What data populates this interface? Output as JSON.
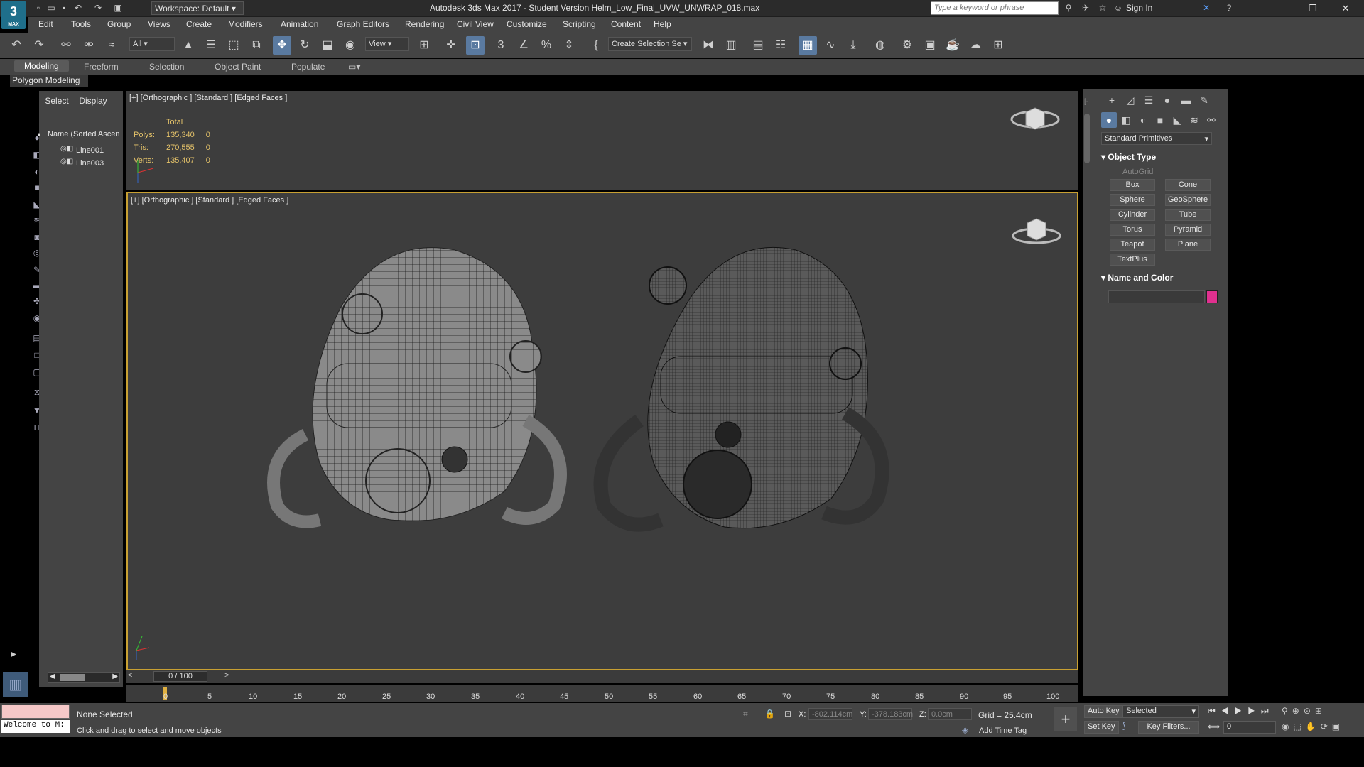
{
  "titlebar": {
    "logo_text": "3",
    "logo_sub": "MAX",
    "workspace": "Workspace: Default",
    "title": "Autodesk 3ds Max 2017 - Student Version     Helm_Low_Final_UVW_UNWRAP_018.max",
    "search_placeholder": "Type a keyword or phrase",
    "signin": "Sign In"
  },
  "menus": [
    "Edit",
    "Tools",
    "Group",
    "Views",
    "Create",
    "Modifiers",
    "Animation",
    "Graph Editors",
    "Rendering",
    "Civil View",
    "Customize",
    "Scripting",
    "Content",
    "Help"
  ],
  "toolbar": {
    "filter": "All",
    "refcoord": "View",
    "selection_set": "Create Selection Se"
  },
  "ribbon": {
    "tabs": [
      "Modeling",
      "Freeform",
      "Selection",
      "Object Paint",
      "Populate"
    ],
    "panel_label": "Polygon Modeling"
  },
  "scene_explorer": {
    "tabs": [
      "Select",
      "Display"
    ],
    "column_header": "Name (Sorted Ascen",
    "items": [
      "Line001",
      "Line003"
    ]
  },
  "viewport_top": {
    "label": "[+] [Orthographic ] [Standard ] [Edged Faces ]",
    "stats": {
      "header": "Total",
      "rows": [
        {
          "label": "Polys:",
          "total": "135,340",
          "sel": "0"
        },
        {
          "label": "Tris:",
          "total": "270,555",
          "sel": "0"
        },
        {
          "label": "Verts:",
          "total": "135,407",
          "sel": "0"
        }
      ]
    }
  },
  "viewport_main": {
    "label": "[+] [Orthographic ] [Standard ] [Edged Faces ]"
  },
  "command_panel": {
    "category": "Standard Primitives",
    "rollout_object_type": "Object Type",
    "autogrid": "AutoGrid",
    "buttons": [
      "Box",
      "Cone",
      "Sphere",
      "GeoSphere",
      "Cylinder",
      "Tube",
      "Torus",
      "Pyramid",
      "Teapot",
      "Plane",
      "TextPlus"
    ],
    "rollout_name_color": "Name and Color",
    "object_color": "#e0308f"
  },
  "timeline": {
    "frame": "0 / 100",
    "ticks": [
      "0",
      "5",
      "10",
      "15",
      "20",
      "25",
      "30",
      "35",
      "40",
      "45",
      "50",
      "55",
      "60",
      "65",
      "70",
      "75",
      "80",
      "85",
      "90",
      "95",
      "100"
    ]
  },
  "status": {
    "welcome": "Welcome to M:",
    "selection": "None Selected",
    "prompt": "Click and drag to select and move objects",
    "x_label": "X:",
    "x_value": "-802.114cm",
    "y_label": "Y:",
    "y_value": "-378.183cm",
    "z_label": "Z:",
    "z_value": "0.0cm",
    "grid": "Grid = 25.4cm",
    "add_time_tag": "Add Time Tag",
    "auto_key": "Auto Key",
    "set_key": "Set Key",
    "key_mode": "Selected",
    "key_filters": "Key Filters...",
    "current_frame": "0"
  }
}
